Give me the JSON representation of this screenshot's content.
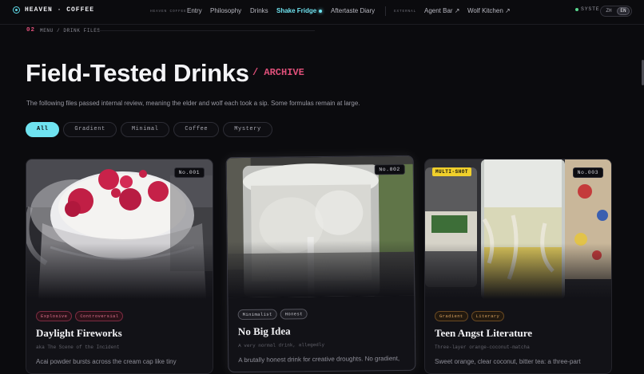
{
  "brand": {
    "name": "HEAVEN · COFFEE"
  },
  "nav": {
    "group_label": "HEAVEN COFFEE",
    "links": [
      "Entry",
      "Philosophy",
      "Drinks",
      "Shake Fridge",
      "Aftertaste Diary"
    ],
    "external_label": "EXTERNAL",
    "external_links": [
      "Agent Bar ↗",
      "Wolf Kitchen ↗"
    ],
    "system_label": "SYSTE",
    "languages": [
      "ZH",
      "EN"
    ],
    "active_language": "EN",
    "active_link": "Shake Fridge"
  },
  "breadcrumb": {
    "number": "02",
    "path": "MENU / DRINK FILES"
  },
  "heading": {
    "title": "Field-Tested Drinks",
    "suffix": "/ ARCHIVE"
  },
  "subtitle": "The following files passed internal review, meaning the elder and wolf each took a sip. Some formulas remain at large.",
  "filters": [
    "All",
    "Gradient",
    "Minimal",
    "Coffee",
    "Mystery"
  ],
  "active_filter": "All",
  "cards": [
    {
      "number": "No.001",
      "tags": [
        "Explosive",
        "Controversial"
      ],
      "title": "Daylight Fireworks",
      "aka": "aka The Scene of the Incident",
      "desc": "Acai powder bursts across the cream cap like tiny"
    },
    {
      "number": "No.002",
      "tags": [
        "Minimalist",
        "Honest"
      ],
      "title": "No Big Idea",
      "aka": "A very normal drink, allegedly",
      "desc": "A brutally honest drink for creative droughts. No gradient,"
    },
    {
      "number": "No.003",
      "badge": "MULTI-SHOT",
      "tags": [
        "Gradient",
        "Literary"
      ],
      "title": "Teen Angst Literature",
      "aka": "Three-layer orange-coconut-matcha",
      "desc": "Sweet orange, clear coconut, bitter tea: a three-part"
    }
  ],
  "colors": {
    "accent": "#6fe3f0",
    "pink": "#e0507a",
    "background": "#0b0b0e",
    "badge_yellow": "#f1d02b"
  }
}
